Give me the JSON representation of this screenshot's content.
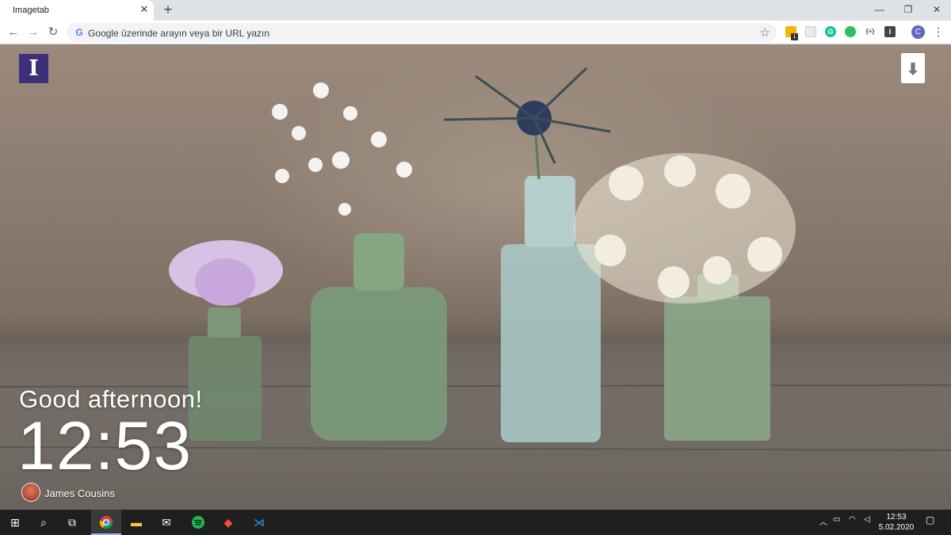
{
  "browser": {
    "tab_title": "Imagetab",
    "tab_close": "✕",
    "new_tab": "+",
    "omnibox_placeholder": "Google üzerinde arayın veya bir URL yazın",
    "profile_initial": "C",
    "extension_badge": "1",
    "window_controls": {
      "minimize": "—",
      "restore": "❐",
      "close": "✕"
    }
  },
  "page": {
    "logo_letter": "I",
    "greeting": "Good afternoon!",
    "time": "12:53",
    "photographer": "James Cousins"
  },
  "taskbar": {
    "clock_time": "12:53",
    "clock_date": "5.02.2020"
  },
  "colors": {
    "logo_bg": "#3d2f78",
    "taskbar_bg": "#1f1f1f",
    "tab_strip_bg": "#dee1e6"
  }
}
